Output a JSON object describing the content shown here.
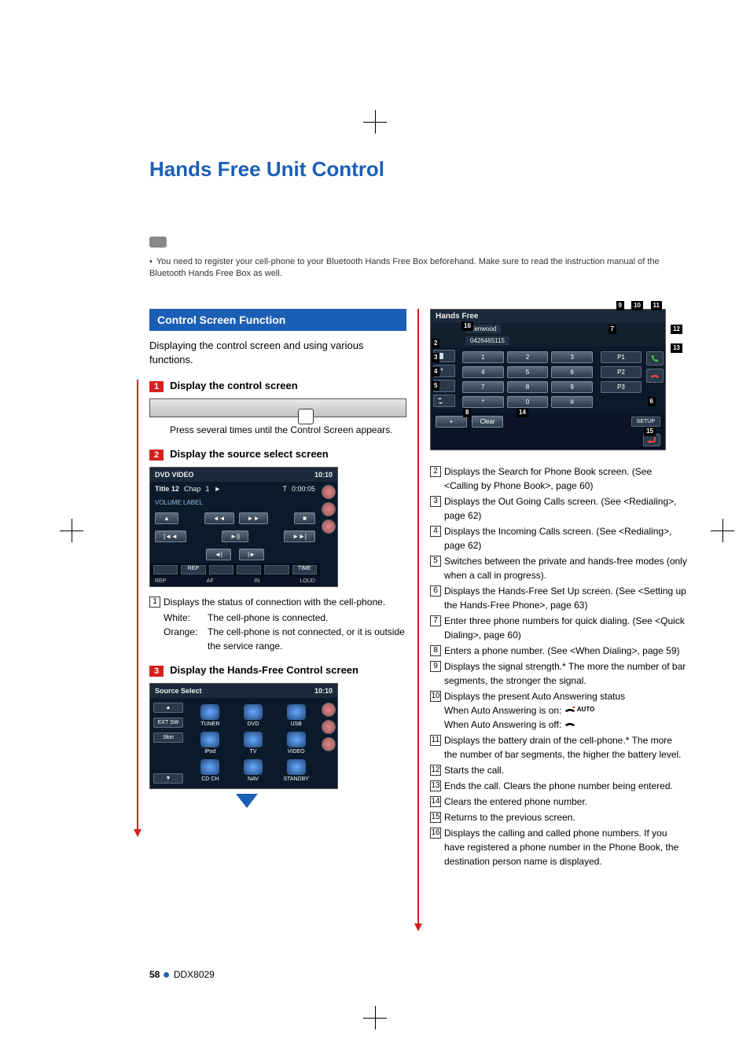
{
  "page_title": "Hands Free Unit Control",
  "note": "You need to register your cell-phone to your Bluetooth Hands Free Box beforehand. Make sure to read the instruction manual of the Bluetooth Hands Free Box as well.",
  "section_header": "Control Screen Function",
  "intro": "Displaying the control screen and using various functions.",
  "steps": {
    "s1": {
      "num": "1",
      "title": "Display the control screen",
      "after": "Press several times until the Control Screen appears."
    },
    "s2": {
      "num": "2",
      "title": "Display the source select screen"
    },
    "s3": {
      "num": "3",
      "title": "Display the Hands-Free Control screen"
    }
  },
  "dvd": {
    "title": "DVD VIDEO",
    "time": "10:10",
    "title_label": "Title 12",
    "chap_label": "Chap",
    "chap_num": "1",
    "play_icon": "►",
    "t_label": "T",
    "elapsed": "0:00:05",
    "volume_label": "VOLUME LABEL",
    "btn_eject": "▲",
    "btn_rew": "◄◄",
    "btn_ff": "►►",
    "btn_stop": "■",
    "btn_prev": "|◄◄",
    "btn_pause": "►||",
    "btn_next": "►►|",
    "btn_step_back": "◄|",
    "btn_step_fwd": "|►",
    "rep": "REP",
    "time_btn": "TIME",
    "af": "AF",
    "in": "IN",
    "loud": "LOUD"
  },
  "item1": {
    "num": "1",
    "text": "Displays the status of connection with the cell-phone.",
    "white_label": "White:",
    "white_text": "The cell-phone is connected.",
    "orange_label": "Orange:",
    "orange_text": "The cell-phone is not connected, or it is outside the service range."
  },
  "src": {
    "title": "Source Select",
    "time": "10:10",
    "up": "▲",
    "down": "▼",
    "ext_sw": "EXT SW",
    "skin": "Skin",
    "cells": [
      "TUNER",
      "DVD",
      "USB",
      "iPod",
      "TV",
      "VIDEO",
      "CD CH",
      "NAV",
      "STANDBY"
    ]
  },
  "hf": {
    "title": "Hands Free",
    "name": "Kenwood",
    "number": "0426465115",
    "keys": [
      "1",
      "2",
      "3",
      "4",
      "5",
      "6",
      "7",
      "8",
      "9",
      "*",
      "0",
      "#"
    ],
    "p1": "P1",
    "p2": "P2",
    "p3": "P3",
    "left_icons": [
      "book",
      "out",
      "in",
      "swap"
    ],
    "plus": "+",
    "clear": "Clear",
    "setup": "SETUP"
  },
  "callouts": {
    "c2": "2",
    "c3": "3",
    "c4": "4",
    "c5": "5",
    "c6": "6",
    "c7": "7",
    "c8": "8",
    "c9": "9",
    "c10": "10",
    "c11": "11",
    "c12": "12",
    "c13": "13",
    "c14": "14",
    "c15": "15",
    "c16": "16"
  },
  "right_list": {
    "i2": {
      "num": "2",
      "text": "Displays the Search for Phone Book screen. (See <Calling by Phone Book>, page 60)"
    },
    "i3": {
      "num": "3",
      "text": "Displays the Out Going Calls screen. (See <Redialing>, page 62)"
    },
    "i4": {
      "num": "4",
      "text": "Displays the Incoming Calls screen. (See <Redialing>, page 62)"
    },
    "i5": {
      "num": "5",
      "text": "Switches between the private and hands-free modes (only when a call in progress)."
    },
    "i6": {
      "num": "6",
      "text": "Displays the Hands-Free Set Up screen. (See <Setting up the Hands-Free Phone>, page 63)"
    },
    "i7": {
      "num": "7",
      "text": "Enter three phone numbers for quick dialing. (See <Quick Dialing>, page 60)"
    },
    "i8": {
      "num": "8",
      "text": "Enters a phone number. (See <When Dialing>, page 59)"
    },
    "i9": {
      "num": "9",
      "text": "Displays the signal strength.* The more the number of bar segments, the stronger the signal."
    },
    "i10": {
      "num": "10",
      "text_a": "Displays the present Auto Answering status",
      "text_b": "When Auto Answering is on:",
      "text_c": "When Auto Answering is off:",
      "auto": "AUTO"
    },
    "i11": {
      "num": "11",
      "text": "Displays the battery drain of the cell-phone.* The more the number of bar segments, the higher the battery level."
    },
    "i12": {
      "num": "12",
      "text": "Starts the call."
    },
    "i13": {
      "num": "13",
      "text": "Ends the call. Clears the phone number being entered."
    },
    "i14": {
      "num": "14",
      "text": "Clears the entered phone number."
    },
    "i15": {
      "num": "15",
      "text": "Returns to the previous screen."
    },
    "i16": {
      "num": "16",
      "text": "Displays the calling and called phone numbers. If you have registered a phone number in the Phone Book, the destination person name is displayed."
    }
  },
  "footer": {
    "page": "58",
    "model": "DDX8029"
  }
}
